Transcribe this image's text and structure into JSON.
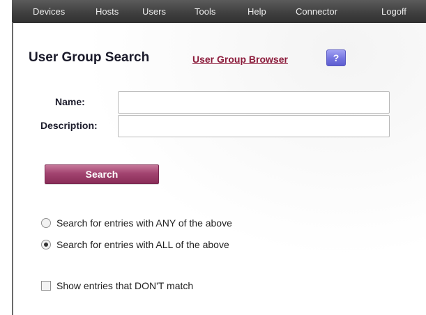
{
  "nav": {
    "items": [
      {
        "label": "Devices"
      },
      {
        "label": "Hosts"
      },
      {
        "label": "Users"
      },
      {
        "label": "Tools"
      },
      {
        "label": "Help"
      },
      {
        "label": "Connector"
      },
      {
        "label": "Logoff"
      }
    ]
  },
  "header": {
    "title": "User Group Search",
    "browser_link": "User Group Browser",
    "help_label": "?"
  },
  "form": {
    "name_label": "Name:",
    "name_value": "",
    "description_label": "Description:",
    "description_value": "",
    "search_label": "Search"
  },
  "options": {
    "match_any": {
      "label": "Search for entries with ANY of the above",
      "checked": false
    },
    "match_all": {
      "label": "Search for entries with ALL of the above",
      "checked": true
    },
    "negate": {
      "label": "Show entries that DON'T match",
      "checked": false
    }
  },
  "colors": {
    "navbar": "#404040",
    "link": "#8b1a3a",
    "search_button": "#a24470",
    "help_button": "#7474e0"
  }
}
